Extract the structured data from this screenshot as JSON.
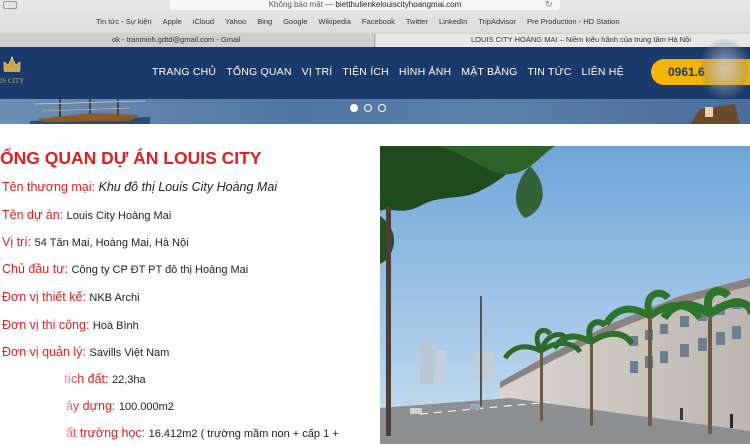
{
  "browser": {
    "url_prefix": "Không bảo mật —",
    "url": "bietthulienkelouiscityhoangmai.com",
    "bookmarks": [
      "Tin tức - Sự kiện",
      "Apple",
      "iCloud",
      "Yahoo",
      "Bing",
      "Google",
      "Wikipedia",
      "Facebook",
      "Twitter",
      "LinkedIn",
      "TripAdvisor",
      "Pre Production - HD Station"
    ],
    "tabs": [
      {
        "label": "ok - tranminh.gdtd@gmail.com - Gmail"
      },
      {
        "label": "LOUIS CITY HOÀNG MAI – Niềm kiêu hãnh của trung tâm Hà Nội"
      }
    ]
  },
  "header": {
    "logo_text": "IS CITY",
    "nav": [
      "TRANG CHỦ",
      "TỔNG QUAN",
      "VỊ TRÍ",
      "TIỆN ÍCH",
      "HÌNH ẢNH",
      "MẶT BẰNG",
      "TIN TỨC",
      "LIÊN HỆ"
    ],
    "phone": "0961.6"
  },
  "colors": {
    "navy": "#1a3a6b",
    "red": "#e02020",
    "yellow": "#f5b400"
  },
  "content": {
    "title": "ỔNG QUAN DỰ ÁN LOUIS CITY",
    "rows": [
      {
        "label": "Tên thương mại",
        "value": "Khu đô thị Louis City Hoàng Mai",
        "italic": true
      },
      {
        "label": "Tên dự án",
        "value": "Louis City Hoàng Mai"
      },
      {
        "label": "Vị trí",
        "value": "54 Tân Mai, Hoàng Mai, Hà Nội"
      },
      {
        "label": "Chủ đầu tư",
        "value": "Công ty CP ĐT PT đô thị Hoàng Mai"
      },
      {
        "label": "Đơn vị thiết kế",
        "value": "NKB Archi"
      },
      {
        "label": "Đơn vị thi công",
        "value": "Hoà Bình"
      },
      {
        "label": "Đơn vị quản lý",
        "value": "Savills Việt Nam"
      },
      {
        "label": "tích đất",
        "value": "22,3ha"
      },
      {
        "label": "ây dựng",
        "value": "100.000m2"
      },
      {
        "label": "ất trường học",
        "value": "16.412m2 ( trường mầm non + cấp 1 +"
      }
    ]
  }
}
